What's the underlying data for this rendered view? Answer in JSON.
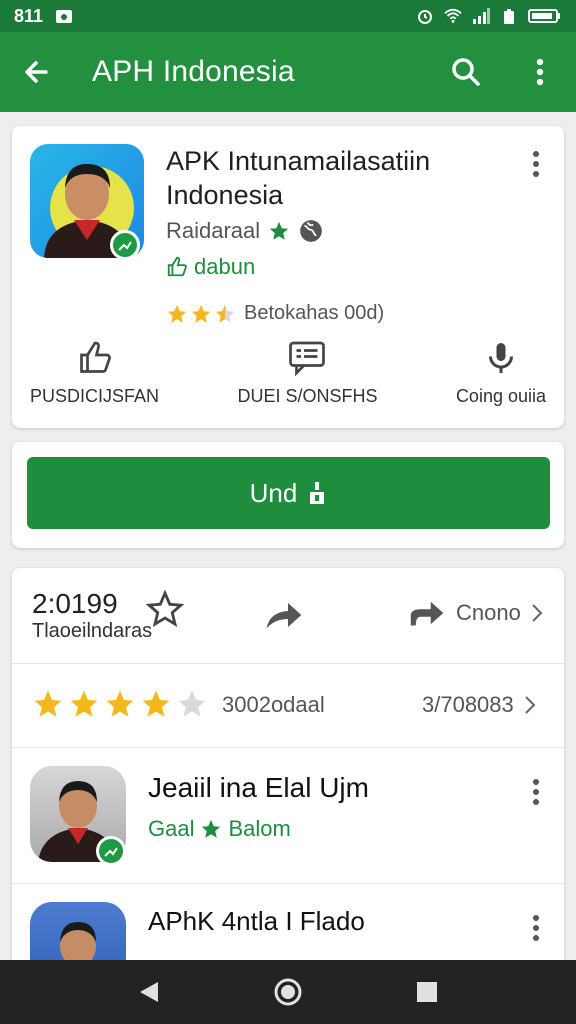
{
  "status_bar": {
    "time": "811",
    "icons": [
      "notification-icon",
      "alarm-icon",
      "wifi-icon",
      "signal-icon",
      "battery-saver-icon",
      "battery-icon"
    ]
  },
  "app_bar": {
    "title": "APH Indonesia",
    "back_icon": "back-arrow-icon",
    "search_icon": "search-icon",
    "menu_icon": "more-vert-icon"
  },
  "app_card": {
    "title": "APK Intunamailasatiin Indonesia",
    "developer": "Raidaraal",
    "like_text": "dabun",
    "rating_text": "Betokahas 00d)",
    "rating_stars": 2.5,
    "actions": [
      {
        "label": "PUSDICIJSFAN",
        "icon": "thumb-up-icon"
      },
      {
        "label": "DUEI S/ONSFHS",
        "icon": "message-icon"
      },
      {
        "label": "Coing ouiia",
        "icon": "mic-icon"
      }
    ]
  },
  "install": {
    "label": "Und"
  },
  "stats": {
    "number": "2:0199",
    "sub": "Tlaoeilndaras",
    "open_label": "Cnono"
  },
  "rating_row": {
    "stars": 4,
    "count": "3002odaal",
    "total": "3/708083"
  },
  "list": [
    {
      "title": "Jeaiil ina Elal Ujm",
      "sub": "Gaal",
      "sub2": "Balom"
    },
    {
      "title": "APhK 4ntla I Flado"
    }
  ],
  "colors": {
    "primary": "#22903f",
    "primary_dark": "#1b7a3a",
    "accent": "#1e8e3e",
    "star": "#f5b81c",
    "star_empty": "#d9d9d9"
  }
}
